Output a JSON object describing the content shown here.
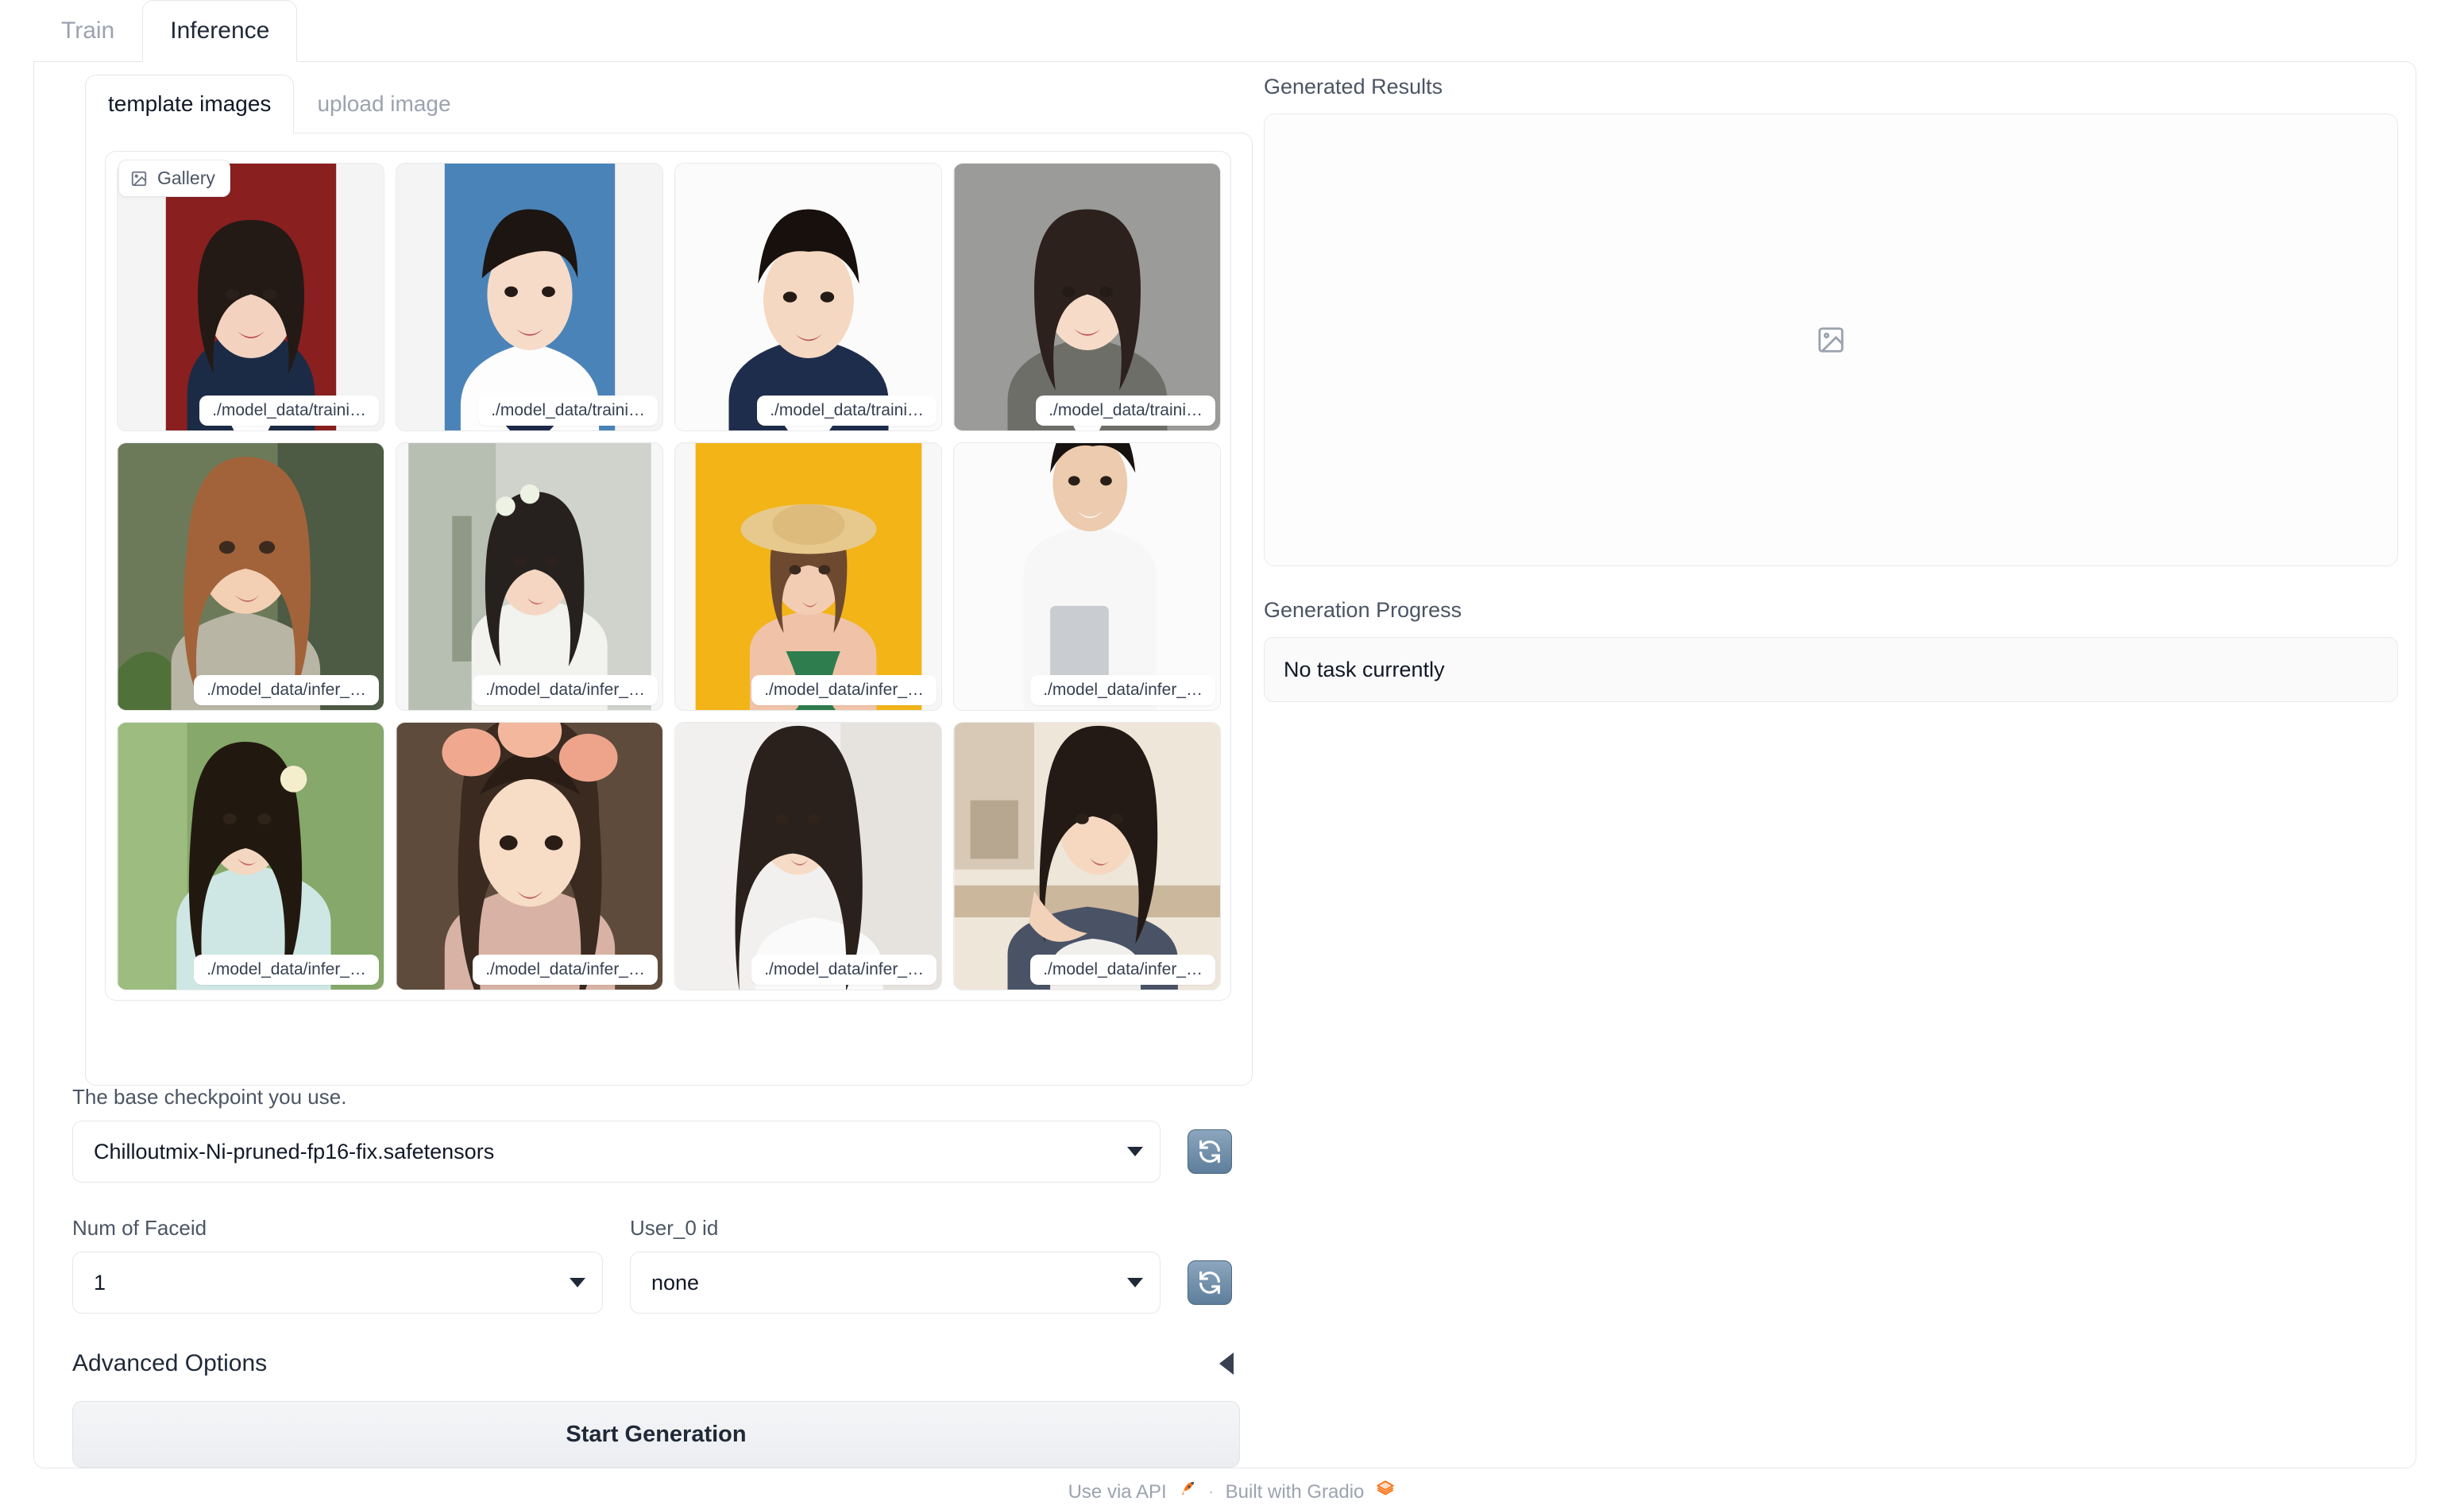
{
  "top_tabs": [
    {
      "label": "Train",
      "active": false
    },
    {
      "label": "Inference",
      "active": true
    }
  ],
  "inner_tabs": [
    {
      "label": "template images",
      "active": true
    },
    {
      "label": "upload image",
      "active": false
    }
  ],
  "gallery": {
    "chip_label": "Gallery",
    "chip_icon": "image-icon",
    "items": [
      {
        "caption": "./model_data/traini…"
      },
      {
        "caption": "./model_data/traini…"
      },
      {
        "caption": "./model_data/traini…"
      },
      {
        "caption": "./model_data/traini…"
      },
      {
        "caption": "./model_data/infer_…"
      },
      {
        "caption": "./model_data/infer_…"
      },
      {
        "caption": "./model_data/infer_…"
      },
      {
        "caption": "./model_data/infer_…"
      },
      {
        "caption": "./model_data/infer_…"
      },
      {
        "caption": "./model_data/infer_…"
      },
      {
        "caption": "./model_data/infer_…"
      },
      {
        "caption": "./model_data/infer_…"
      }
    ]
  },
  "controls": {
    "checkpoint_label": "The base checkpoint you use.",
    "checkpoint_value": "Chilloutmix-Ni-pruned-fp16-fix.safetensors",
    "num_faceid_label": "Num of Faceid",
    "num_faceid_value": "1",
    "user_id_label": "User_0 id",
    "user_id_value": "none",
    "refresh_icon": "refresh-icon",
    "advanced_options_label": "Advanced Options",
    "advanced_options_arrow": "triangle-left-icon",
    "start_generation_label": "Start Generation"
  },
  "results": {
    "generated_results_label": "Generated Results",
    "placeholder_icon": "image-placeholder-icon",
    "progress_label": "Generation Progress",
    "progress_value": "No task currently"
  },
  "footer": {
    "api_label": "Use via API",
    "api_icon": "rocket-icon",
    "separator": "·",
    "gradio_label": "Built with Gradio",
    "gradio_icon": "gradio-logo-icon"
  },
  "colors": {
    "accent": "#f97316",
    "border": "#e5e7eb",
    "text": "#1f2937",
    "muted": "#9ca3af"
  }
}
